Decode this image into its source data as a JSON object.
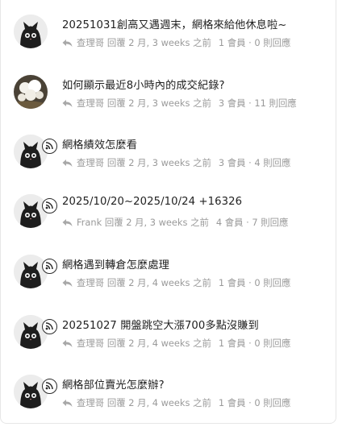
{
  "topics": [
    {
      "title": "20251031創高又遇週末，網格來給他休息啦~",
      "author": "查理哥",
      "replied": "回覆 2 月, 3 weeks 之前",
      "members": "1 會員",
      "replies": "0 則回應",
      "avatar": "cat-avatar",
      "rss": false
    },
    {
      "title": "如何顯示最近8小時內的成交紀錄?",
      "author": "查理哥",
      "replied": "回覆 2 月, 3 weeks 之前",
      "members": "3 會員",
      "replies": "11 則回應",
      "avatar": "flower-avatar",
      "rss": false
    },
    {
      "title": "網格績效怎麼看",
      "author": "查理哥",
      "replied": "回覆 2 月, 3 weeks 之前",
      "members": "3 會員",
      "replies": "4 則回應",
      "avatar": "cat-avatar",
      "rss": true
    },
    {
      "title": "2025/10/20~2025/10/24 +16326",
      "author": "Frank",
      "replied": "回覆 2 月, 3 weeks 之前",
      "members": "4 會員",
      "replies": "7 則回應",
      "avatar": "cat-avatar",
      "rss": true
    },
    {
      "title": "網格遇到轉倉怎麼處理",
      "author": "查理哥",
      "replied": "回覆 2 月, 4 weeks 之前",
      "members": "1 會員",
      "replies": "0 則回應",
      "avatar": "cat-avatar",
      "rss": true
    },
    {
      "title": "20251027 開盤跳空大漲700多點沒賺到",
      "author": "查理哥",
      "replied": "回覆 2 月, 4 weeks 之前",
      "members": "1 會員",
      "replies": "0 則回應",
      "avatar": "cat-avatar",
      "rss": true
    },
    {
      "title": "網格部位賣光怎麼辦?",
      "author": "查理哥",
      "replied": "回覆 2 月, 4 weeks 之前",
      "members": "1 會員",
      "replies": "0 則回應",
      "avatar": "cat-avatar",
      "rss": true
    }
  ],
  "colors": {
    "title": "#222222",
    "meta": "#9a9a9a",
    "border": "#e6e6e6"
  }
}
